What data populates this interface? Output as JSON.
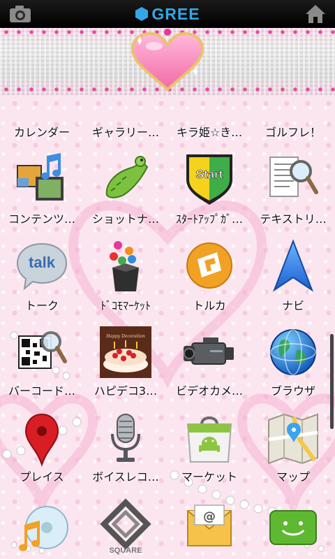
{
  "status_bar": {
    "brand": "GREE",
    "left_icon": "camera-icon",
    "right_icon": "home-icon"
  },
  "apps": [
    {
      "label": "カレンダー"
    },
    {
      "label": "ギャラリー…"
    },
    {
      "label": "キラ姫☆き…"
    },
    {
      "label": "ゴルフレ！"
    },
    {
      "label": "コンテンツ…"
    },
    {
      "label": "ショットナ…"
    },
    {
      "label": "ｽﾀｰﾄｱｯﾌﾟｶﾞ…"
    },
    {
      "label": "テキストリ…"
    },
    {
      "label": "トーク"
    },
    {
      "label": "ﾄﾞｺﾓﾏｰｹｯﾄ"
    },
    {
      "label": "トルカ"
    },
    {
      "label": "ナビ"
    },
    {
      "label": "バーコード…"
    },
    {
      "label": "ハピデコ3…"
    },
    {
      "label": "ビデオカメ…"
    },
    {
      "label": "ブラウザ"
    },
    {
      "label": "プレイス"
    },
    {
      "label": "ボイスレコ…"
    },
    {
      "label": "マーケット"
    },
    {
      "label": "マップ"
    }
  ],
  "icon_text": {
    "start": "Start",
    "talk": "talk",
    "square": "SQUARE",
    "cake": "Happy Decoration"
  },
  "colors": {
    "brand_blue": "#35a6e8",
    "wallpaper_pink": "#fbe6ef"
  }
}
